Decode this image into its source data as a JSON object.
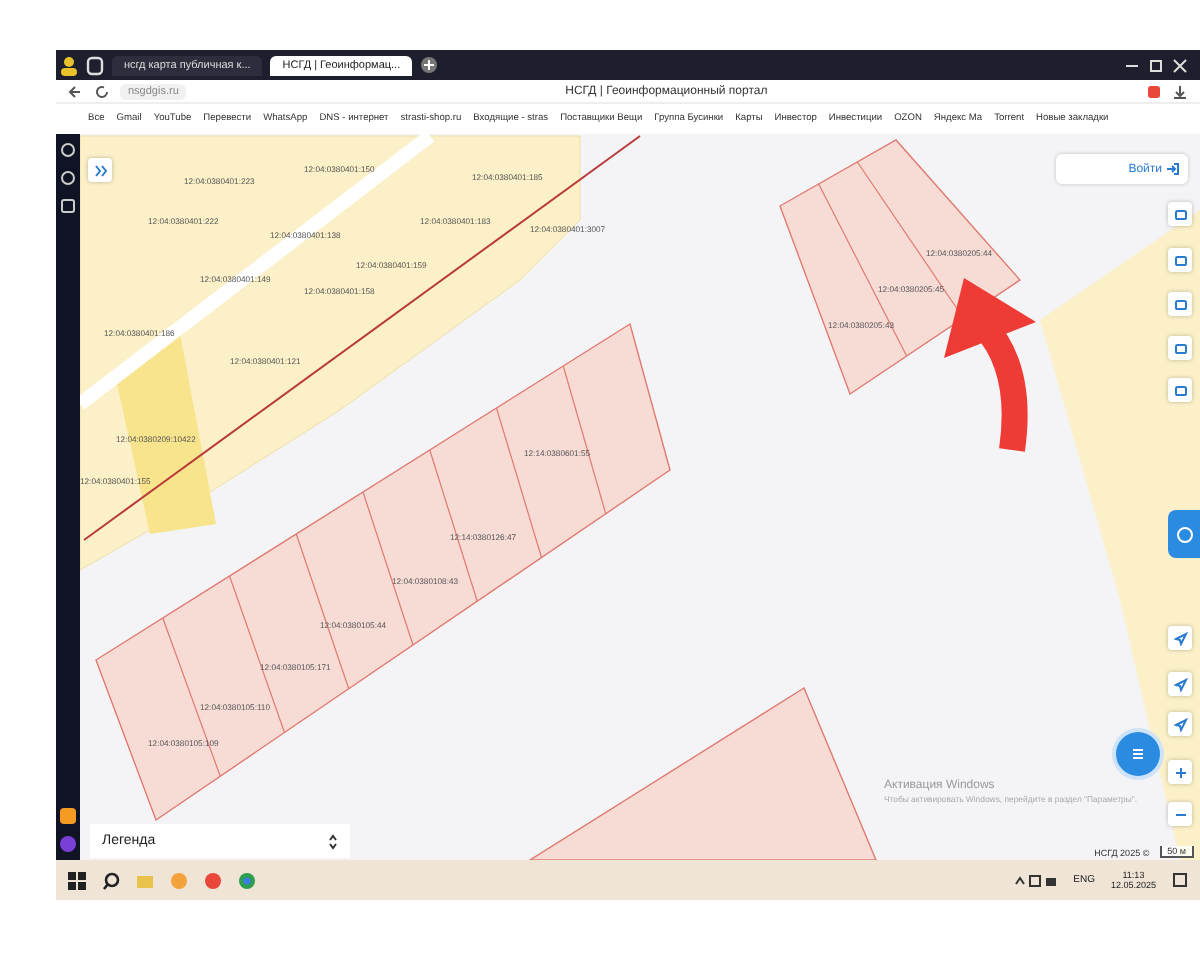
{
  "browser": {
    "tabs": [
      {
        "title": "нсгд карта публичная к...",
        "selected": false
      },
      {
        "title": "НСГД | Геоинформац...",
        "selected": true
      }
    ],
    "address": "nsgdgis.ru",
    "page_title": "НСГД | Геоинформационный портал",
    "bookmarks": [
      "Все",
      "Gmail",
      "YouTube",
      "Перевести",
      "WhatsApp",
      "DNS - интернет",
      "strasti-shop.ru",
      "Входящие - stras",
      "Поставщики Вещи",
      "Группа Бусинки",
      "Карты",
      "Инвестор",
      "Инвестиции",
      "OZON",
      "Яндекс Ма",
      "Torrent",
      "Новые закладки"
    ]
  },
  "map": {
    "parcel_labels": [
      "12:04:0380401:223",
      "12:04:0380401:150",
      "12:04:0380401:185",
      "12:04:0380401:222",
      "12:04:0380401:138",
      "12:04:0380401:183",
      "12:04:0380401:3007",
      "12:04:0380401:149",
      "12:04:0380401:159",
      "12:04:0380401:186",
      "12:04:0380401:158",
      "12:04:0380401:121",
      "12:04:0380209:10422",
      "12:04:0380401:155",
      "12:14:0380601:55",
      "12:14:0380126:47",
      "12:04:0380108:43",
      "12:04:0380105:44",
      "12:04:0380105:171",
      "12:04:0380105:110",
      "12:04:0380105:109",
      "12:04:0380205:44",
      "12:04:0380205:45",
      "12:04:0380205:43"
    ],
    "login_button": "Войти",
    "legend": "Легенда",
    "attribution": "НСГД 2025 ©",
    "scale": "50 м",
    "activation": {
      "title": "Активация Windows",
      "text": "Чтобы активировать Windows, перейдите в раздел \"Параметры\"."
    }
  },
  "taskbar": {
    "language": "ENG",
    "time": "11:13",
    "date": "12.05.2025"
  }
}
